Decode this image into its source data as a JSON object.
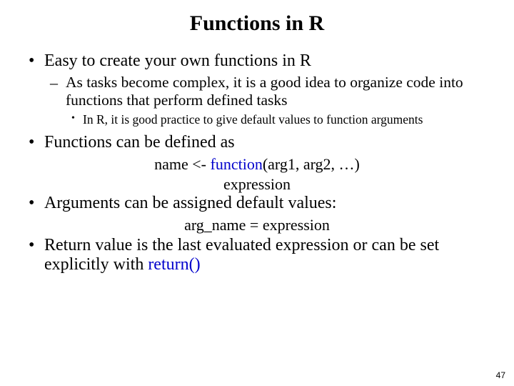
{
  "title": "Functions in R",
  "bullets": {
    "b1": {
      "text": "Easy to create your own functions in R",
      "sub": {
        "s1": {
          "text": "As tasks become complex, it is a good idea to organize code into functions that perform defined tasks",
          "sub": {
            "t1": "In R, it is good practice to give default values to function arguments"
          }
        }
      }
    },
    "b2": {
      "text": "Functions can be defined as",
      "code": {
        "line1_plain1": "name <- ",
        "line1_blue": "function",
        "line1_plain2": "(arg1, arg2, …)",
        "line2": "expression"
      }
    },
    "b3": {
      "text": "Arguments can be assigned default values:",
      "code": {
        "line1": "arg_name = expression"
      }
    },
    "b4": {
      "plain1": "Return value is the last evaluated expression or can be set explicitly with ",
      "blue": "return()"
    }
  },
  "page": "47"
}
